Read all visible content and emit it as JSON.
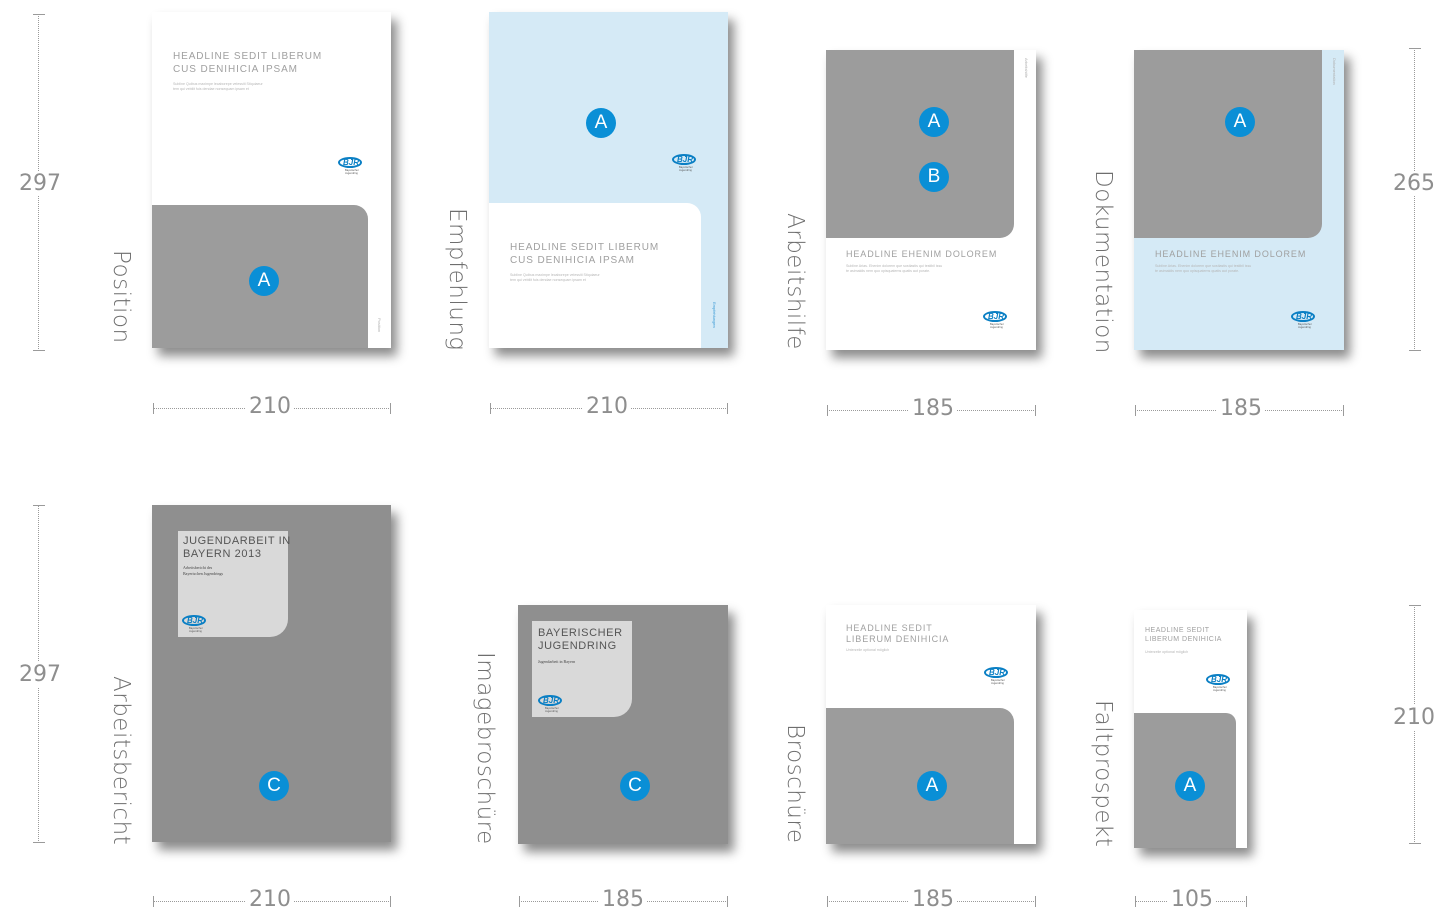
{
  "labels": {
    "position": "Position",
    "empfehlung": "Empfehlung",
    "arbeitshilfe": "Arbeitshilfe",
    "dokumentation": "Dokumentation",
    "arbeitsbericht": "Arbeitsbericht",
    "imagebroschuere": "Imagebroschüre",
    "broschuere": "Broschüre",
    "faltprospekt": "Faltprospekt"
  },
  "dimensions": {
    "w_position": "210",
    "w_empfehlung": "210",
    "w_arbeitshilfe": "185",
    "w_dokumentation": "185",
    "w_arbeitsbericht": "210",
    "w_imagebroschuere": "185",
    "w_broschuere": "185",
    "w_faltprospekt": "105",
    "h_row1_left": "297",
    "h_row1_right": "265",
    "h_row2_left": "297",
    "h_row2_right": "210"
  },
  "badges": {
    "a": "A",
    "b": "B",
    "c": "C"
  },
  "covers": {
    "headline_long_1": "HEADLINE SEDIT LIBERUM",
    "headline_long_2": "CUS DENIHICIA IPSAM",
    "sub_long_1": "Subline Quibus maximpe lecaborepe velessiti Stiquiaeur",
    "sub_long_2": "tem qui vebilit fuis dendae nonsequam ipsam et",
    "headline_eh": "HEADLINE EHENIM DOLOREM",
    "sub_eh_1": "Subline Arias. Ehenim dolorem que sostiastis qui testibil issu",
    "sub_eh_2": "te asimaldis nem quo opisquatems quatis aut porate.",
    "headline_short_1": "HEADLINE SEDIT",
    "headline_short_2": "LIBERUM DENIHICIA",
    "sub_short": "Unterzeile optional möglich",
    "spine_position": "Position",
    "spine_empfehlung": "Empfehlungen",
    "spine_arbeitshilfe": "Arbeitshilfe",
    "spine_dokumentation": "Dokumentation",
    "jb_head_1": "JUGENDARBEIT IN",
    "jb_head_2": "BAYERN 2013",
    "jb_sub_1": "Arbeitsbericht des",
    "jb_sub_2": "Bayerischen Jugendrings",
    "ib_head_1": "BAYERISCHER",
    "ib_head_2": "JUGENDRING",
    "ib_sub": "Jugendarbeit in Bayern",
    "logo_text": "BJR",
    "logo_sub_1": "Bayerischer",
    "logo_sub_2": "Jugendring"
  },
  "colors": {
    "accent_blue": "#0a8fd6",
    "light_blue": "#d5eaf6",
    "grey_panel": "#9c9c9c"
  }
}
